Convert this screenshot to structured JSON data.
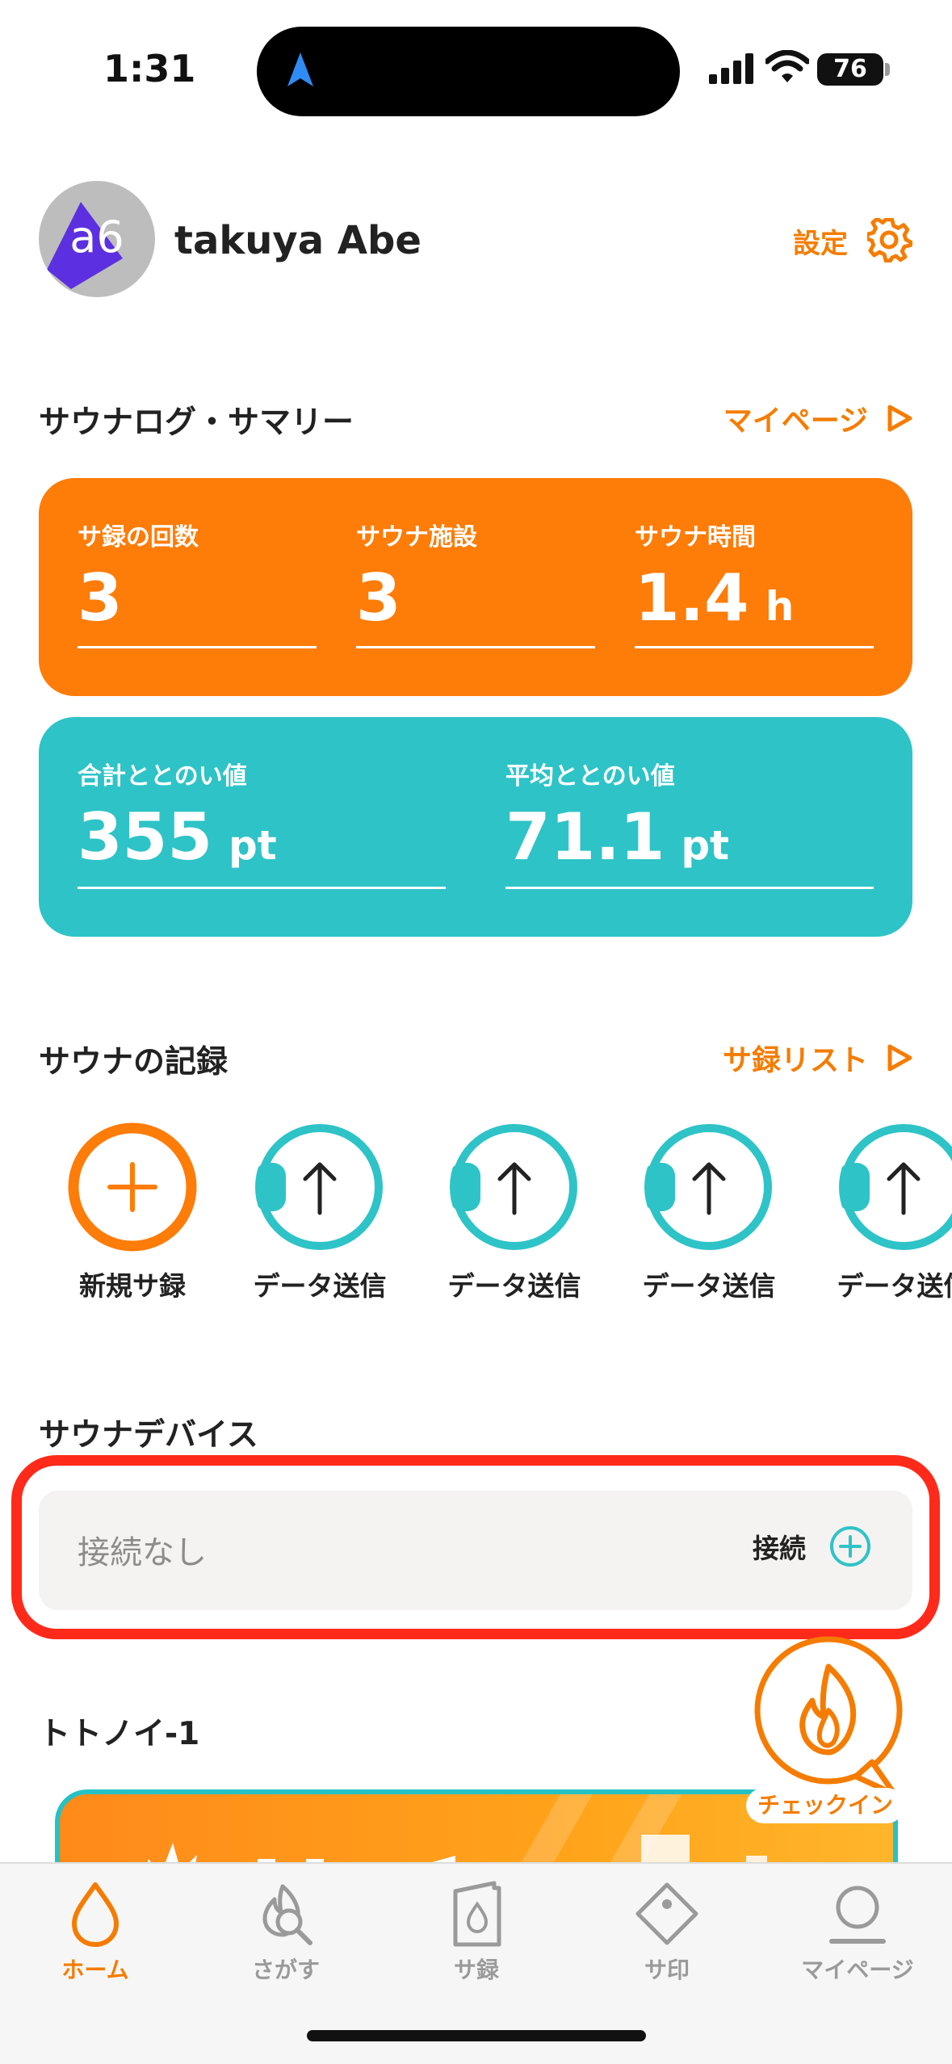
{
  "status_bar": {
    "time": "1:31",
    "battery": "76"
  },
  "profile": {
    "avatar_text": "a6",
    "name": "takuya Abe",
    "settings_label": "設定"
  },
  "summary": {
    "title": "サウナログ・サマリー",
    "link_label": "マイページ",
    "stats_orange": [
      {
        "label": "サ録の回数",
        "value": "3",
        "unit": ""
      },
      {
        "label": "サウナ施設",
        "value": "3",
        "unit": ""
      },
      {
        "label": "サウナ時間",
        "value": "1.4",
        "unit": "h"
      }
    ],
    "stats_teal": [
      {
        "label": "合計ととのい値",
        "value": "355",
        "unit": "pt"
      },
      {
        "label": "平均ととのい値",
        "value": "71.1",
        "unit": "pt"
      }
    ]
  },
  "records": {
    "title": "サウナの記録",
    "link_label": "サ録リスト",
    "items": [
      {
        "label": "新規サ録"
      },
      {
        "label": "データ送信"
      },
      {
        "label": "データ送信"
      },
      {
        "label": "データ送信"
      },
      {
        "label": "データ送信"
      }
    ]
  },
  "device": {
    "title": "サウナデバイス",
    "status": "接続なし",
    "connect_label": "接続"
  },
  "totonoi": {
    "title": "トトノイ-1"
  },
  "checkin": {
    "label": "チェックイン"
  },
  "tabs": [
    {
      "label": "ホーム",
      "icon": "drop-icon",
      "active": true
    },
    {
      "label": "さがす",
      "icon": "flame-search-icon",
      "active": false
    },
    {
      "label": "サ録",
      "icon": "note-drop-icon",
      "active": false
    },
    {
      "label": "サ印",
      "icon": "stamp-icon",
      "active": false
    },
    {
      "label": "マイページ",
      "icon": "person-icon",
      "active": false
    }
  ],
  "colors": {
    "accent": "#fe7c08",
    "teal": "#2ec3c7",
    "highlight": "#ff2a1a"
  }
}
